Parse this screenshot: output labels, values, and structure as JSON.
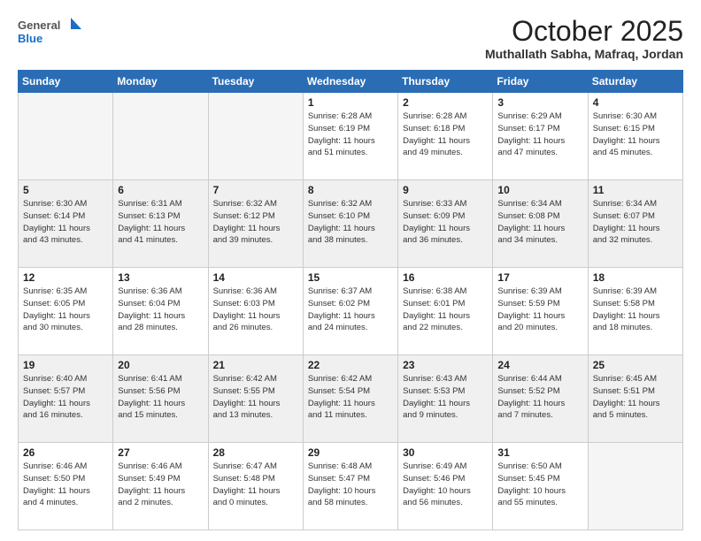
{
  "header": {
    "logo_line1": "General",
    "logo_line2": "Blue",
    "month": "October 2025",
    "location": "Muthallath Sabha, Mafraq, Jordan"
  },
  "days_of_week": [
    "Sunday",
    "Monday",
    "Tuesday",
    "Wednesday",
    "Thursday",
    "Friday",
    "Saturday"
  ],
  "weeks": [
    [
      {
        "day": "",
        "info": ""
      },
      {
        "day": "",
        "info": ""
      },
      {
        "day": "",
        "info": ""
      },
      {
        "day": "1",
        "info": "Sunrise: 6:28 AM\nSunset: 6:19 PM\nDaylight: 11 hours\nand 51 minutes."
      },
      {
        "day": "2",
        "info": "Sunrise: 6:28 AM\nSunset: 6:18 PM\nDaylight: 11 hours\nand 49 minutes."
      },
      {
        "day": "3",
        "info": "Sunrise: 6:29 AM\nSunset: 6:17 PM\nDaylight: 11 hours\nand 47 minutes."
      },
      {
        "day": "4",
        "info": "Sunrise: 6:30 AM\nSunset: 6:15 PM\nDaylight: 11 hours\nand 45 minutes."
      }
    ],
    [
      {
        "day": "5",
        "info": "Sunrise: 6:30 AM\nSunset: 6:14 PM\nDaylight: 11 hours\nand 43 minutes."
      },
      {
        "day": "6",
        "info": "Sunrise: 6:31 AM\nSunset: 6:13 PM\nDaylight: 11 hours\nand 41 minutes."
      },
      {
        "day": "7",
        "info": "Sunrise: 6:32 AM\nSunset: 6:12 PM\nDaylight: 11 hours\nand 39 minutes."
      },
      {
        "day": "8",
        "info": "Sunrise: 6:32 AM\nSunset: 6:10 PM\nDaylight: 11 hours\nand 38 minutes."
      },
      {
        "day": "9",
        "info": "Sunrise: 6:33 AM\nSunset: 6:09 PM\nDaylight: 11 hours\nand 36 minutes."
      },
      {
        "day": "10",
        "info": "Sunrise: 6:34 AM\nSunset: 6:08 PM\nDaylight: 11 hours\nand 34 minutes."
      },
      {
        "day": "11",
        "info": "Sunrise: 6:34 AM\nSunset: 6:07 PM\nDaylight: 11 hours\nand 32 minutes."
      }
    ],
    [
      {
        "day": "12",
        "info": "Sunrise: 6:35 AM\nSunset: 6:05 PM\nDaylight: 11 hours\nand 30 minutes."
      },
      {
        "day": "13",
        "info": "Sunrise: 6:36 AM\nSunset: 6:04 PM\nDaylight: 11 hours\nand 28 minutes."
      },
      {
        "day": "14",
        "info": "Sunrise: 6:36 AM\nSunset: 6:03 PM\nDaylight: 11 hours\nand 26 minutes."
      },
      {
        "day": "15",
        "info": "Sunrise: 6:37 AM\nSunset: 6:02 PM\nDaylight: 11 hours\nand 24 minutes."
      },
      {
        "day": "16",
        "info": "Sunrise: 6:38 AM\nSunset: 6:01 PM\nDaylight: 11 hours\nand 22 minutes."
      },
      {
        "day": "17",
        "info": "Sunrise: 6:39 AM\nSunset: 5:59 PM\nDaylight: 11 hours\nand 20 minutes."
      },
      {
        "day": "18",
        "info": "Sunrise: 6:39 AM\nSunset: 5:58 PM\nDaylight: 11 hours\nand 18 minutes."
      }
    ],
    [
      {
        "day": "19",
        "info": "Sunrise: 6:40 AM\nSunset: 5:57 PM\nDaylight: 11 hours\nand 16 minutes."
      },
      {
        "day": "20",
        "info": "Sunrise: 6:41 AM\nSunset: 5:56 PM\nDaylight: 11 hours\nand 15 minutes."
      },
      {
        "day": "21",
        "info": "Sunrise: 6:42 AM\nSunset: 5:55 PM\nDaylight: 11 hours\nand 13 minutes."
      },
      {
        "day": "22",
        "info": "Sunrise: 6:42 AM\nSunset: 5:54 PM\nDaylight: 11 hours\nand 11 minutes."
      },
      {
        "day": "23",
        "info": "Sunrise: 6:43 AM\nSunset: 5:53 PM\nDaylight: 11 hours\nand 9 minutes."
      },
      {
        "day": "24",
        "info": "Sunrise: 6:44 AM\nSunset: 5:52 PM\nDaylight: 11 hours\nand 7 minutes."
      },
      {
        "day": "25",
        "info": "Sunrise: 6:45 AM\nSunset: 5:51 PM\nDaylight: 11 hours\nand 5 minutes."
      }
    ],
    [
      {
        "day": "26",
        "info": "Sunrise: 6:46 AM\nSunset: 5:50 PM\nDaylight: 11 hours\nand 4 minutes."
      },
      {
        "day": "27",
        "info": "Sunrise: 6:46 AM\nSunset: 5:49 PM\nDaylight: 11 hours\nand 2 minutes."
      },
      {
        "day": "28",
        "info": "Sunrise: 6:47 AM\nSunset: 5:48 PM\nDaylight: 11 hours\nand 0 minutes."
      },
      {
        "day": "29",
        "info": "Sunrise: 6:48 AM\nSunset: 5:47 PM\nDaylight: 10 hours\nand 58 minutes."
      },
      {
        "day": "30",
        "info": "Sunrise: 6:49 AM\nSunset: 5:46 PM\nDaylight: 10 hours\nand 56 minutes."
      },
      {
        "day": "31",
        "info": "Sunrise: 6:50 AM\nSunset: 5:45 PM\nDaylight: 10 hours\nand 55 minutes."
      },
      {
        "day": "",
        "info": ""
      }
    ]
  ]
}
